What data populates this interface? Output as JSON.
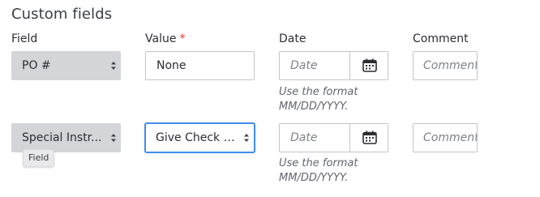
{
  "section": {
    "title": "Custom fields"
  },
  "columns": {
    "field": "Field",
    "value": "Value",
    "value_required_mark": "*",
    "date": "Date",
    "comment": "Comment"
  },
  "rows": [
    {
      "field": "PO #",
      "value": "None",
      "date_placeholder": "Date",
      "comment_placeholder": "Comment",
      "hint_line1": "Use the format",
      "hint_line2": "MM/DD/YYYY."
    },
    {
      "field": "Special Instr...",
      "value": "Give Check t...",
      "date_placeholder": "Date",
      "comment_placeholder": "Comment",
      "hint_line1": "Use the format",
      "hint_line2": "MM/DD/YYYY."
    }
  ],
  "tooltip": {
    "text": "Field"
  },
  "icons": {
    "select": "chevron-up-down-icon",
    "calendar": "calendar-icon"
  },
  "colors": {
    "required": "#e0373a",
    "focus": "#3f8df0",
    "select_bg": "#d4d5d9"
  }
}
